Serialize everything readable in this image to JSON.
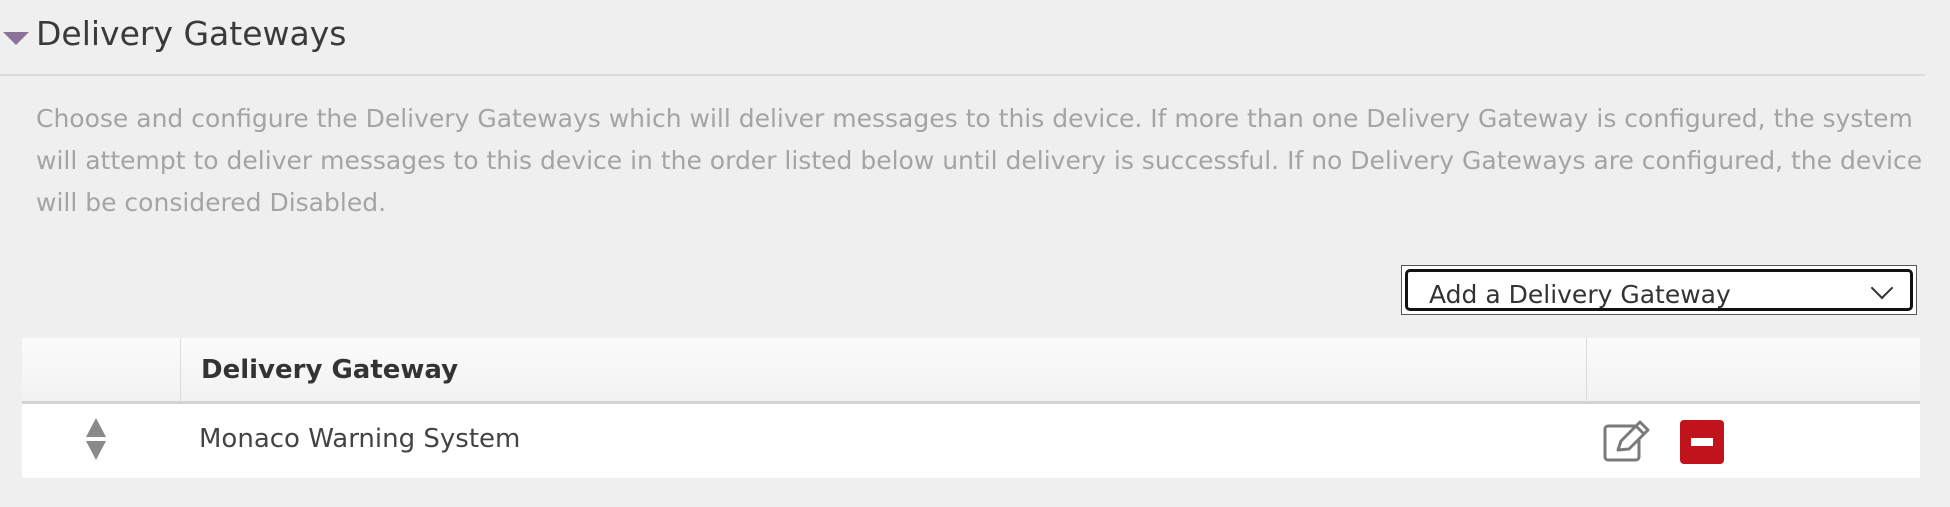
{
  "section": {
    "title": "Delivery Gateways",
    "description": "Choose and configure the Delivery Gateways which will deliver messages to this device. If more than one Delivery Gateway is configured, the system will attempt to deliver messages to this device in the order listed below until delivery is successful. If no Delivery Gateways are configured, the device will be considered Disabled.",
    "collapse_icon": "caret-down-icon",
    "accent_color": "#8a7396"
  },
  "add_gateway": {
    "selected": "Add a Delivery Gateway",
    "icon": "chevron-down-icon"
  },
  "table": {
    "columns": [
      "",
      "Delivery Gateway",
      ""
    ],
    "rows": [
      {
        "gateway": "Monaco Warning System",
        "reorder_icon": "reorder-handle-icon",
        "edit_icon": "edit-icon",
        "remove_icon": "remove-icon"
      }
    ],
    "remove_color": "#c0131b"
  }
}
